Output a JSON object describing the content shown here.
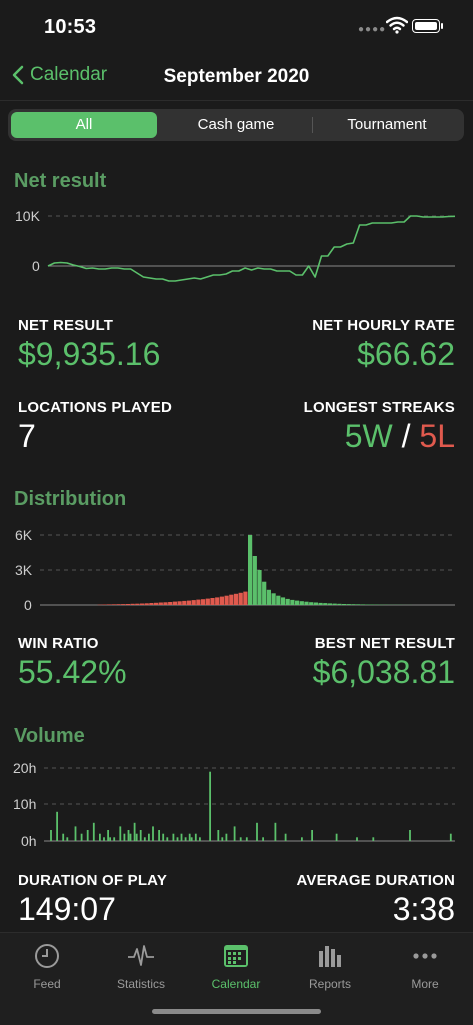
{
  "status_bar": {
    "time": "10:53"
  },
  "nav": {
    "back_label": "Calendar",
    "title": "September 2020"
  },
  "filter": {
    "options": [
      "All",
      "Cash game",
      "Tournament"
    ],
    "selected": "All"
  },
  "net_section": {
    "title": "Net result",
    "chart_data": {
      "type": "line",
      "y_ticks": [
        "10K",
        "0"
      ],
      "ylim": [
        -3000,
        10000
      ],
      "grid": true,
      "series": [
        {
          "values": [
            0,
            600,
            700,
            600,
            200,
            -100,
            -500,
            -400,
            -600,
            -600,
            -400,
            -400,
            -600,
            -600,
            -1400,
            -2200,
            -2400,
            -2600,
            -2600,
            -3000,
            -3000,
            -2800,
            -2600,
            -2400,
            -2600,
            -2200,
            -1800,
            -1800,
            -1600,
            -1000,
            -1000,
            -400,
            -800,
            -400,
            -600,
            -600,
            -1000,
            -1000,
            -1000,
            -1800,
            -1800,
            0,
            -2200,
            2000,
            2000,
            3800,
            3800,
            4400,
            4600,
            8200,
            8200,
            8600,
            8600,
            8600,
            8600,
            8800,
            8800,
            10000,
            10000,
            9800,
            9800,
            9800,
            9800,
            9900,
            9935
          ]
        }
      ]
    }
  },
  "stats1": {
    "net_result_label": "NET RESULT",
    "net_result_value": "$9,935.16",
    "hourly_label": "NET HOURLY RATE",
    "hourly_value": "$66.62",
    "locations_label": "LOCATIONS PLAYED",
    "locations_value": "7",
    "streaks_label": "LONGEST STREAKS",
    "streak_win": "5W",
    "streak_sep": "/",
    "streak_loss": "5L"
  },
  "dist_section": {
    "title": "Distribution",
    "chart_data": {
      "type": "bar",
      "y_ticks": [
        "6K",
        "3K",
        "0"
      ],
      "ylim": [
        0,
        6000
      ],
      "grid": true,
      "losses": [
        30,
        40,
        50,
        60,
        70,
        80,
        90,
        100,
        110,
        130,
        150,
        170,
        190,
        210,
        230,
        260,
        290,
        320,
        350,
        380,
        420,
        460,
        500,
        550,
        600,
        650,
        720,
        800,
        880,
        960,
        1050,
        1150
      ],
      "wins": [
        6000,
        4200,
        3000,
        2000,
        1300,
        1000,
        800,
        650,
        520,
        440,
        380,
        330,
        280,
        240,
        210,
        180,
        160,
        140,
        120,
        100,
        90,
        80,
        70,
        60,
        50,
        45,
        40,
        35,
        30,
        25,
        20,
        18,
        15,
        12,
        10
      ]
    }
  },
  "stats2": {
    "win_ratio_label": "WIN RATIO",
    "win_ratio_value": "55.42%",
    "best_label": "BEST NET RESULT",
    "best_value": "$6,038.81"
  },
  "volume_section": {
    "title": "Volume",
    "chart_data": {
      "type": "bar",
      "y_ticks": [
        "20h",
        "10h",
        "0h"
      ],
      "ylim": [
        0,
        20
      ],
      "grid": true,
      "bars": [
        [
          0.02,
          3
        ],
        [
          0.05,
          8
        ],
        [
          0.08,
          2
        ],
        [
          0.1,
          1
        ],
        [
          0.14,
          4
        ],
        [
          0.17,
          2
        ],
        [
          0.2,
          3
        ],
        [
          0.23,
          5
        ],
        [
          0.26,
          2
        ],
        [
          0.28,
          1
        ],
        [
          0.3,
          3
        ],
        [
          0.31,
          1
        ],
        [
          0.33,
          1
        ],
        [
          0.36,
          4
        ],
        [
          0.38,
          2
        ],
        [
          0.4,
          3
        ],
        [
          0.41,
          2
        ],
        [
          0.43,
          5
        ],
        [
          0.44,
          2
        ],
        [
          0.46,
          3
        ],
        [
          0.48,
          1
        ],
        [
          0.5,
          2
        ],
        [
          0.52,
          4
        ],
        [
          0.55,
          3
        ],
        [
          0.57,
          2
        ],
        [
          0.59,
          1
        ],
        [
          0.62,
          2
        ],
        [
          0.64,
          1
        ],
        [
          0.66,
          2
        ],
        [
          0.68,
          1
        ],
        [
          0.7,
          2
        ],
        [
          0.71,
          1
        ],
        [
          0.73,
          2
        ],
        [
          0.75,
          1
        ],
        [
          0.8,
          19
        ],
        [
          0.84,
          3
        ],
        [
          0.86,
          1
        ],
        [
          0.88,
          2
        ],
        [
          0.92,
          4
        ],
        [
          0.95,
          1
        ],
        [
          0.98,
          1
        ],
        [
          1.03,
          5
        ],
        [
          1.06,
          1
        ],
        [
          1.12,
          5
        ],
        [
          1.17,
          2
        ],
        [
          1.25,
          1
        ],
        [
          1.3,
          3
        ],
        [
          1.42,
          2
        ],
        [
          1.52,
          1
        ],
        [
          1.6,
          1
        ],
        [
          1.78,
          3
        ],
        [
          1.98,
          2
        ]
      ]
    }
  },
  "stats3": {
    "duration_label": "DURATION OF PLAY",
    "duration_value": "149:07",
    "avg_label": "AVERAGE DURATION",
    "avg_value": "3:38"
  },
  "tabs": [
    {
      "label": "Feed",
      "icon": "clock-icon"
    },
    {
      "label": "Statistics",
      "icon": "pulse-icon"
    },
    {
      "label": "Calendar",
      "icon": "calendar-icon"
    },
    {
      "label": "Reports",
      "icon": "bar-chart-icon"
    },
    {
      "label": "More",
      "icon": "ellipsis-icon"
    }
  ],
  "colors": {
    "accent": "#5bc06b",
    "loss": "#e05a4e",
    "section_title": "#5a9c63",
    "background": "#1b1b1b"
  }
}
